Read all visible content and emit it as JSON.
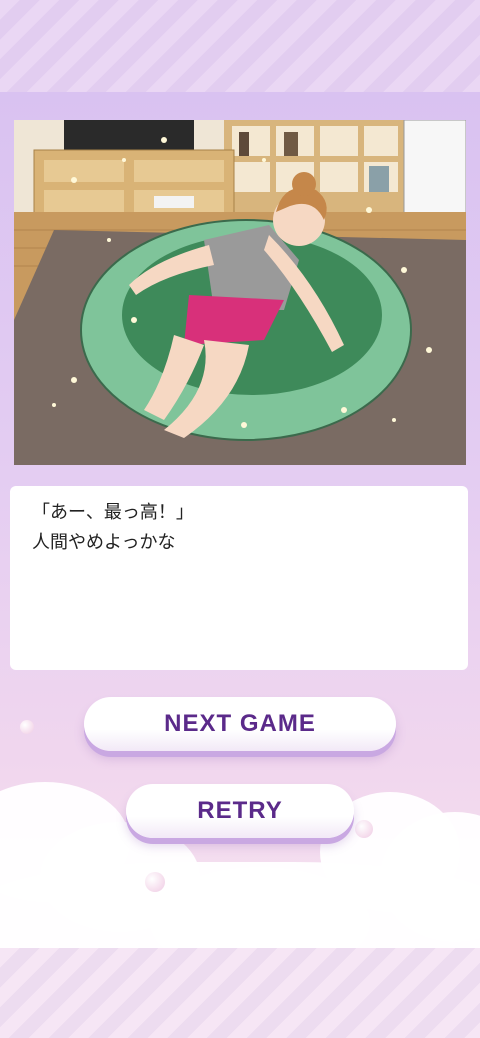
{
  "dialog": {
    "line1": "「あー、最っ高！」",
    "line2": "人間やめよっかな"
  },
  "buttons": {
    "next_game": "NEXT GAME",
    "retry": "RETRY"
  },
  "colors": {
    "button_text": "#5b2a8a",
    "panel_top": "#d9c2f1",
    "panel_bottom": "#f6e3f0"
  },
  "scene": {
    "icon": "woman-relaxing-on-beanbag-illustration"
  }
}
